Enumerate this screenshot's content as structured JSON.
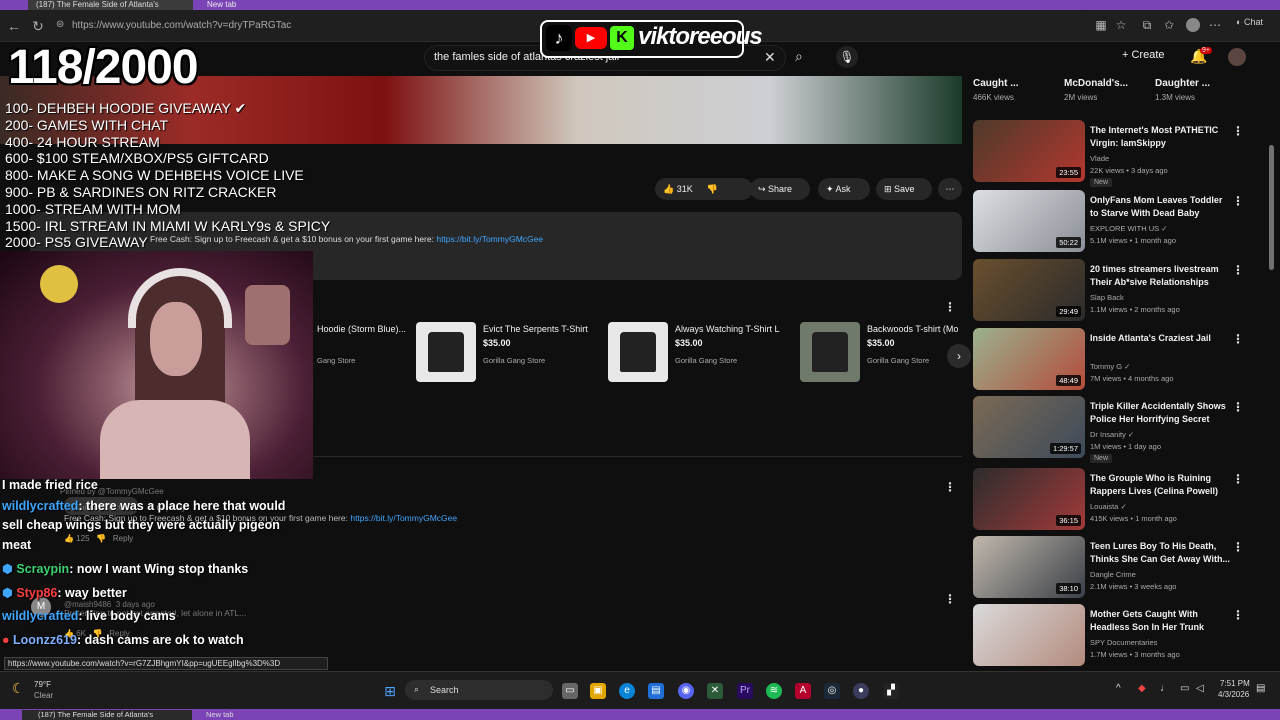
{
  "browser": {
    "tabs": [
      "(187) The Female Side of Atlanta's",
      "New tab"
    ],
    "url": "https://www.youtube.com/watch?v=dryTPaRGTac",
    "chat_label": "Chat",
    "status_url": "https://www.youtube.com/watch?v=rG7ZJBhgmYI&pp=ugUEEgIlbg%3D%3D"
  },
  "youtube": {
    "search_value": "the famles side of atlantas craziest jail",
    "create_label": "Create",
    "notif_count": "9+"
  },
  "overlay": {
    "brand": "viktoreeous",
    "counter": "118/2000",
    "goals": [
      "100- DEHBEH HOODIE GIVEAWAY ✔",
      "200- GAMES WITH CHAT",
      "400- 24 HOUR STREAM",
      "600- $100 STEAM/XBOX/PS5 GIFTCARD",
      "800- MAKE A SONG W DEHBEHS VOICE LIVE",
      "900- PB & SARDINES ON RITZ CRACKER",
      "1000- STREAM WITH MOM",
      "1500- IRL STREAM IN MIAMI W KARLY9s & SPICY",
      "2000- PS5 GIVEAWAY"
    ]
  },
  "video": {
    "like_count": "31K",
    "share_label": "Share",
    "ask_label": "Ask",
    "save_label": "Save",
    "desc_text": "Free Cash: Sign up to Freecash & get a $10 bonus on your first game here:",
    "desc_link": "https://bit.ly/TommyGMcGee"
  },
  "merch": [
    {
      "name": "Hoodie (Storm Blue)...",
      "price": "",
      "store": "Gang Store"
    },
    {
      "name": "Evict The Serpents T-Shirt L",
      "price": "$35.00",
      "store": "Gorilla Gang Store"
    },
    {
      "name": "Always Watching T-Shirt L",
      "price": "$35.00",
      "store": "Gorilla Gang Store"
    },
    {
      "name": "Backwoods T-shirt (Mo",
      "price": "$35.00",
      "store": "Gorilla Gang Store"
    }
  ],
  "chat": [
    {
      "user": "",
      "msg": "I made fried rice",
      "user_color": "#ffffff"
    },
    {
      "user": "wildlycrafted",
      "msg": ": there was a place here that would",
      "user_color": "#3ea6ff"
    },
    {
      "user": "",
      "msg": "sell cheap wings but they were actually pigeon",
      "user_color": "#ffffff"
    },
    {
      "user": "",
      "msg": "meat",
      "user_color": "#ffffff"
    },
    {
      "user": "Scraypin",
      "msg": ": now I want Wing stop thanks",
      "user_color": "#3cd070"
    },
    {
      "user": "Styp86",
      "msg": ": way better",
      "user_color": "#ff4040"
    },
    {
      "user": "wildlycrafted",
      "msg": ": live body cams",
      "user_color": "#3ea6ff"
    },
    {
      "user": "Loonzz619",
      "msg": ": dash cams are ok to watch",
      "user_color": "#7fb0ff"
    }
  ],
  "comments": {
    "pinned_by": "Pinned by @TommyGMcGee",
    "author": "@TommyGMcGee",
    "time": "2 days ago",
    "text": "Free Cash: Sign up to Freecash & get a $10 bonus on your first game here:",
    "link": "https://bit.ly/TommyGMcGee",
    "likes": "125",
    "reply": "Reply",
    "c2_author": "@maish9486",
    "c2_time": "3 days ago",
    "c2_text": "Pretending to not get arrested, let alone in ATL...",
    "c2_likes": "6K",
    "c2_reply": "Reply"
  },
  "top_cards": [
    {
      "title": "Caught ...",
      "views": "466K views"
    },
    {
      "title": "McDonald's...",
      "views": "2M views"
    },
    {
      "title": "Daughter ...",
      "views": "1.3M views"
    }
  ],
  "recs": [
    {
      "title": "The Internet's Most PATHETIC Virgin: IamSkippy",
      "channel": "Vlade",
      "meta": "22K views • 3 days ago",
      "badge": "New",
      "duration": "23:55",
      "color1": "#4d3a2a",
      "color2": "#b4372f"
    },
    {
      "title": "OnlyFans Mom Leaves Toddler to Starve With Dead Baby",
      "channel": "EXPLORE WITH US ✓",
      "meta": "5.1M views • 1 month ago",
      "badge": "",
      "duration": "50:22",
      "color1": "#dcdfe3",
      "color2": "#8b8f96"
    },
    {
      "title": "20 times streamers livestream Their Ab*sive Relationships",
      "channel": "Slap Back",
      "meta": "1.1M views • 2 months ago",
      "badge": "",
      "duration": "29:49",
      "color1": "#6a4f2e",
      "color2": "#2b2b2b"
    },
    {
      "title": "Inside Atlanta's Craziest Jail",
      "channel": "Tommy G ✓",
      "meta": "7M views • 4 months ago",
      "badge": "",
      "duration": "48:49",
      "color1": "#9ab28e",
      "color2": "#b44b3b"
    },
    {
      "title": "Triple Killer Accidentally Shows Police Her Horrifying Secret",
      "channel": "Dr Insanity ✓",
      "meta": "1M views • 1 day ago",
      "badge": "New",
      "duration": "1:29:57",
      "color1": "#7b6a55",
      "color2": "#3c4a5a"
    },
    {
      "title": "The Groupie Who is Ruining Rappers Lives (Celina Powell)",
      "channel": "Louaista ✓",
      "meta": "415K views • 1 month ago",
      "badge": "",
      "duration": "36:15",
      "color1": "#2c2c2c",
      "color2": "#a33a3a"
    },
    {
      "title": "Teen Lures Boy To His Death, Thinks She Can Get Away With...",
      "channel": "Dangle Crime",
      "meta": "2.1M views • 3 weeks ago",
      "badge": "",
      "duration": "38:10",
      "color1": "#c2b9ad",
      "color2": "#3a3f47"
    },
    {
      "title": "Mother Gets Caught With Headless Son In Her Trunk",
      "channel": "SPY Documentaries",
      "meta": "1.7M views • 3 months ago",
      "badge": "",
      "duration": "",
      "color1": "#dadada",
      "color2": "#b38a7d"
    }
  ],
  "taskbar": {
    "weather_temp": "79°F",
    "weather_cond": "Clear",
    "search_label": "Search",
    "time": "7:51 PM",
    "date": "4/3/2026"
  }
}
